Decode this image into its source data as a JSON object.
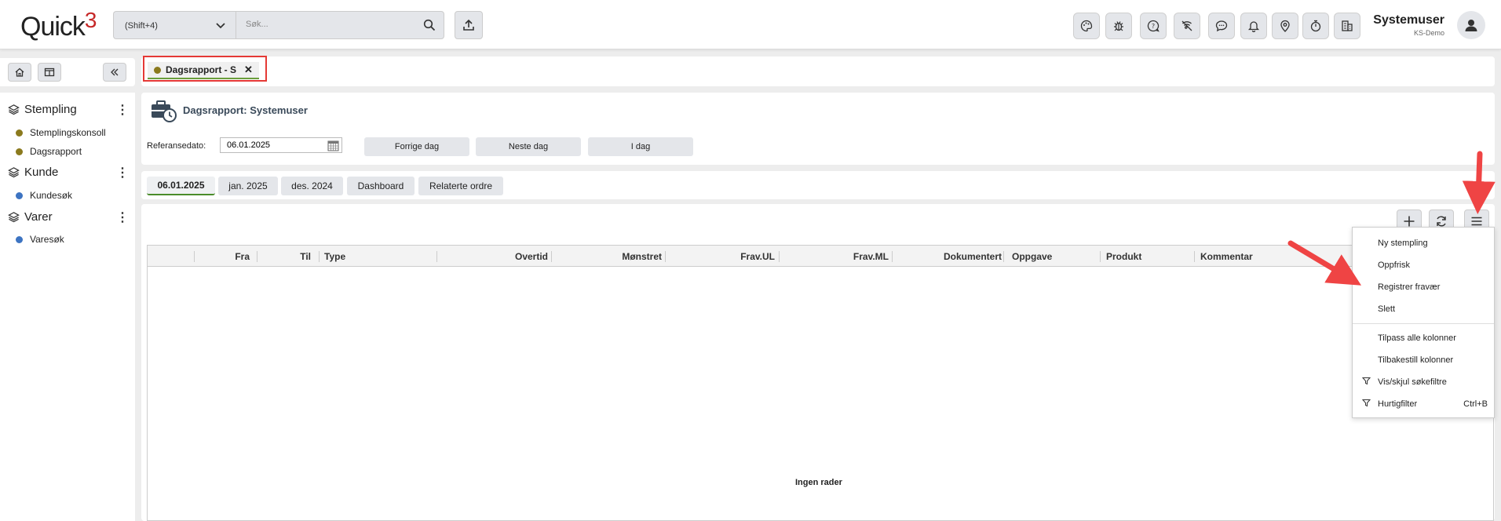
{
  "app": {
    "logo_text": "Quick",
    "logo_number": "3"
  },
  "topbar": {
    "shortcut_label": "(Shift+4)",
    "search_placeholder": "Søk...",
    "icons": [
      "palette-icon",
      "bug-icon",
      "help-bubble-icon",
      "no-signal-icon",
      "chat-icon",
      "bell-icon",
      "location-pin-icon",
      "stopwatch-icon",
      "building-icon"
    ],
    "user_name": "Systemuser",
    "user_org": "KS-Demo"
  },
  "sidebar": {
    "sections": [
      {
        "title": "Stempling",
        "items": [
          {
            "label": "Stemplingskonsoll",
            "color": "#8b7a1e"
          },
          {
            "label": "Dagsrapport",
            "color": "#8b7a1e"
          }
        ]
      },
      {
        "title": "Kunde",
        "items": [
          {
            "label": "Kundesøk",
            "color": "#3d74c2"
          }
        ]
      },
      {
        "title": "Varer",
        "items": [
          {
            "label": "Varesøk",
            "color": "#3d74c2"
          }
        ]
      }
    ]
  },
  "tabs": {
    "open_tab": "Dagsrapport - S",
    "dot_color": "#8b7a1e"
  },
  "header": {
    "title": "Dagsrapport: Systemuser",
    "ref_label": "Referansedato:",
    "ref_date": "06.01.2025",
    "prev_day": "Forrige dag",
    "next_day": "Neste dag",
    "today": "I dag"
  },
  "subtabs": [
    "06.01.2025",
    "jan. 2025",
    "des. 2024",
    "Dashboard",
    "Relaterte ordre"
  ],
  "grid": {
    "columns": [
      "Fra",
      "Til",
      "Type",
      "Overtid",
      "Mønstret",
      "Frav.UL",
      "Frav.ML",
      "Dokumentert",
      "Oppgave",
      "Produkt",
      "Kommentar"
    ],
    "empty_text": "Ingen rader"
  },
  "menu": {
    "items": [
      "Ny stempling",
      "Oppfrisk",
      "Registrer fravær",
      "Slett"
    ],
    "items2": [
      "Tilpass alle kolonner",
      "Tilbakestill kolonner",
      "Vis/skjul søkefiltre",
      "Hurtigfilter"
    ],
    "shortcut": "Ctrl+B"
  },
  "colors": {
    "accent_red": "#e53935",
    "active_green": "#4a8c2a"
  }
}
